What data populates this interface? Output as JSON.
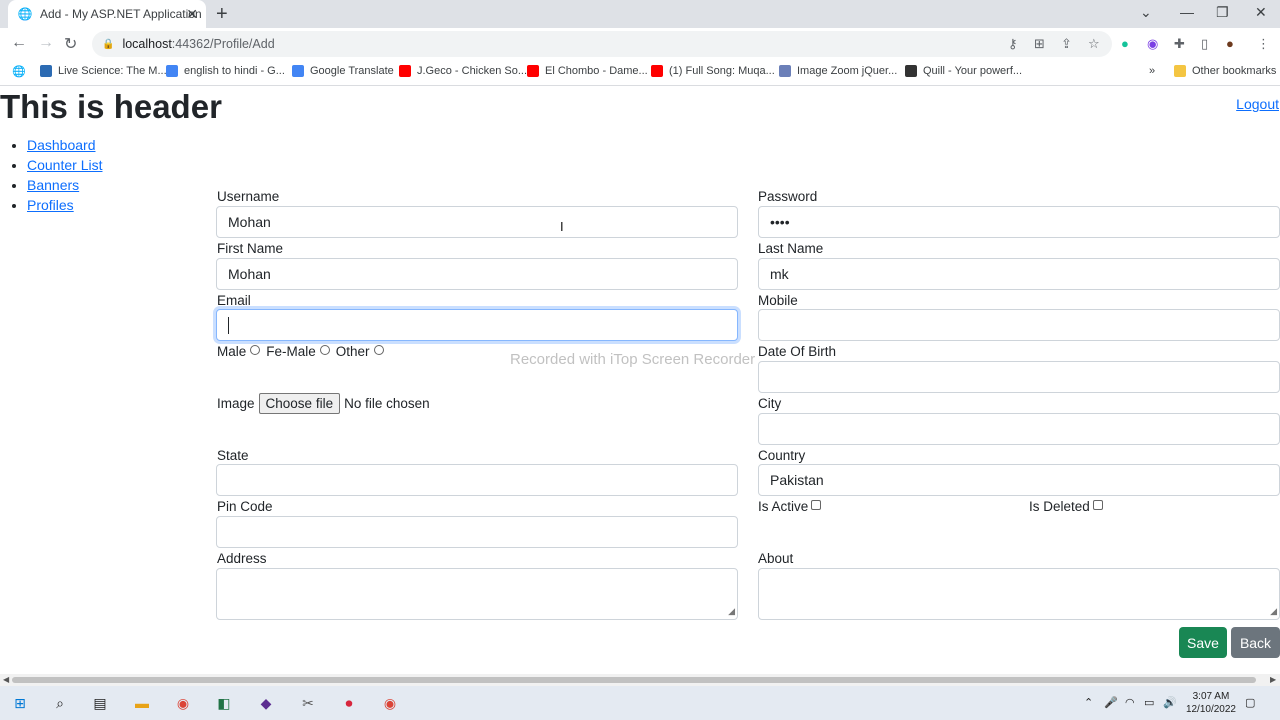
{
  "browser": {
    "tab_title": "Add - My ASP.NET Application",
    "url_host": "localhost",
    "url_path": ":44362/Profile/Add",
    "bookmarks": [
      {
        "label": "Live Science: The M...",
        "color": "#2c6bb3"
      },
      {
        "label": "english to hindi - G...",
        "color": "#4285f4"
      },
      {
        "label": "Google Translate",
        "color": "#4285f4"
      },
      {
        "label": "J.Geco - Chicken So...",
        "color": "#ff0000"
      },
      {
        "label": "El Chombo - Dame...",
        "color": "#ff0000"
      },
      {
        "label": "(1) Full Song: Muqa...",
        "color": "#ff0000"
      },
      {
        "label": "Image Zoom jQuer...",
        "color": "#6b7fb8"
      },
      {
        "label": "Quill - Your powerf...",
        "color": "#333333"
      }
    ],
    "other_bookmarks": "Other bookmarks"
  },
  "page": {
    "header": "This is header",
    "logout": "Logout",
    "nav": [
      "Dashboard",
      "Counter List",
      "Banners",
      "Profiles"
    ]
  },
  "form": {
    "username_label": "Username",
    "username_value": "Mohan",
    "password_label": "Password",
    "password_value": "••••",
    "firstname_label": "First Name",
    "firstname_value": "Mohan",
    "lastname_label": "Last Name",
    "lastname_value": "mk",
    "email_label": "Email",
    "email_value": "",
    "mobile_label": "Mobile",
    "gender_male": "Male",
    "gender_female": "Fe-Male",
    "gender_other": "Other",
    "dob_label": "Date Of Birth",
    "image_label": "Image",
    "file_button": "Choose file",
    "file_status": "No file chosen",
    "city_label": "City",
    "state_label": "State",
    "country_label": "Country",
    "country_value": "Pakistan",
    "pincode_label": "Pin Code",
    "is_active_label": "Is Active",
    "is_deleted_label": "Is Deleted",
    "address_label": "Address",
    "about_label": "About",
    "save_label": "Save",
    "back_label": "Back",
    "save_color": "#198754",
    "back_color": "#6c757d"
  },
  "watermark": "Recorded with iTop Screen Recorder",
  "taskbar": {
    "time": "3:07 AM",
    "date": "12/10/2022"
  }
}
